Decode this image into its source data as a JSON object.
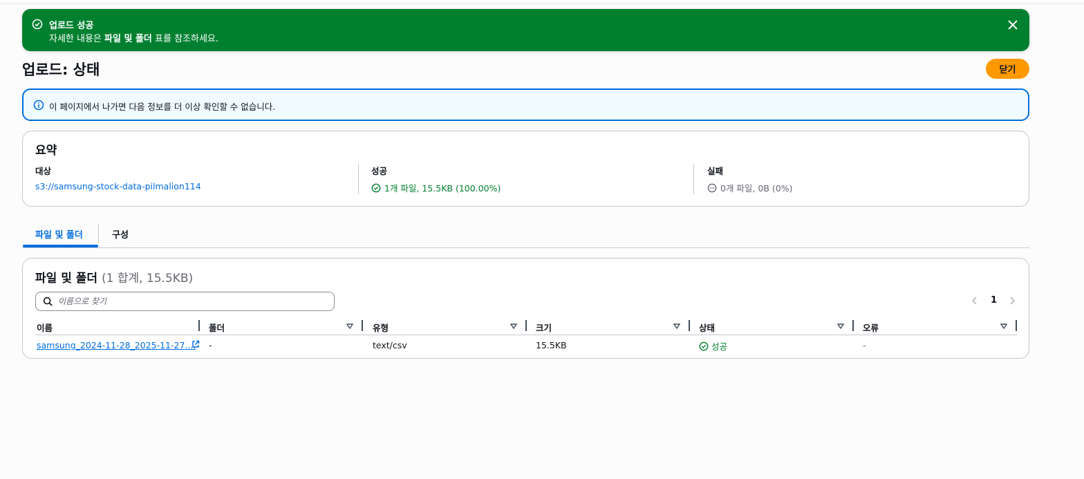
{
  "flash": {
    "title": "업로드 성공",
    "desc_prefix": "자세한 내용은 ",
    "desc_bold": "파일 및 폴더",
    "desc_suffix": " 표를 참조하세요."
  },
  "header": {
    "title": "업로드: 상태",
    "close_label": "닫기"
  },
  "info_alert": {
    "text": "이 페이지에서 나가면 다음 정보를 더 이상 확인할 수 없습니다."
  },
  "summary": {
    "title": "요약",
    "target_label": "대상",
    "target_value": "s3://samsung-stock-data-pilmalion114",
    "success_label": "성공",
    "success_value": "1개 파일, 15.5KB (100.00%)",
    "failure_label": "실패",
    "failure_value": "0개 파일, 0B (0%)"
  },
  "tabs": [
    {
      "label": "파일 및 폴더",
      "active": true
    },
    {
      "label": "구성",
      "active": false
    }
  ],
  "files": {
    "title": "파일 및 폴더",
    "count": "(1 합계, 15.5KB)",
    "search_placeholder": "이름으로 찾기",
    "page": "1",
    "columns": [
      "이름",
      "폴더",
      "유형",
      "크기",
      "상태",
      "오류"
    ],
    "rows": [
      {
        "name": "samsung_2024-11-28_2025-11-27....",
        "folder": "-",
        "type": "text/csv",
        "size": "15.5KB",
        "status": "성공",
        "error": "-"
      }
    ]
  },
  "colors": {
    "success": "#00802f",
    "link": "#006ce0",
    "primary_button": "#ff9900"
  }
}
